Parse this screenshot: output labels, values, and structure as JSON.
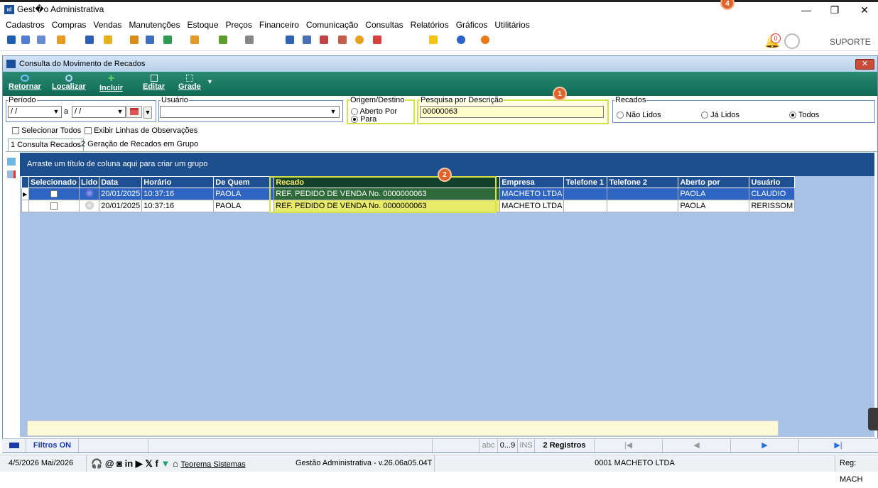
{
  "window": {
    "title": "Gest�o Administrativa",
    "badge": "4"
  },
  "menu": [
    "Cadastros",
    "Compras",
    "Vendas",
    "Manutenções",
    "Estoque",
    "Preços",
    "Financeiro",
    "Comunicação",
    "Consultas",
    "Relatórios",
    "Gráficos",
    "Utilitários"
  ],
  "topright": {
    "suporte": "SUPORTE",
    "bell_badge": "0"
  },
  "inner": {
    "title": "Consulta do Movimento de Recados",
    "close": "✕",
    "actions": [
      {
        "label": "Retornar",
        "color": "#6fc3ff"
      },
      {
        "label": "Localizar",
        "color": "#b8d6ff"
      },
      {
        "label": "Incluir",
        "color": "#5fd65f"
      },
      {
        "label": "Editar",
        "color": "#ffffff"
      },
      {
        "label": "Grade",
        "color": "#ffffff"
      }
    ]
  },
  "filters": {
    "periodo_legend": "Período",
    "date_from": " / /",
    "date_sep": "a",
    "date_to": " / /",
    "usuario_legend": "Usuário",
    "usuario_value": "",
    "origem_legend": "Origem/Destino",
    "origem_opt1": "Aberto Por",
    "origem_opt2": "Para",
    "pesquisa_legend": "Pesquisa por Descrição",
    "pesquisa_value": "00000063",
    "recados_legend": "Recados",
    "recados_opt1": "Não Lidos",
    "recados_opt2": "Já Lidos",
    "recados_opt3": "Todos",
    "selecionar_todos": "Selecionar Todos",
    "exibir_linhas": "Exibir Linhas de Observações",
    "badge1": "1",
    "badge2": "2"
  },
  "tabs": [
    "1 Consulta Recados",
    "2 Geração de Recados em Grupo"
  ],
  "grid": {
    "group_hint": "Arraste um título de coluna aqui para criar um grupo",
    "columns": [
      "Selecionado",
      "Lido",
      "Data",
      "Horário",
      "De Quem",
      "Recado",
      "Empresa",
      "Telefone 1",
      "Telefone 2",
      "Aberto por",
      "Usuário"
    ],
    "rows": [
      [
        "",
        "",
        "20/01/2025",
        "10:37:16",
        "PAOLA",
        "REF. PEDIDO DE VENDA No. 0000000063",
        "MACHETO LTDA",
        "",
        "",
        "PAOLA",
        "CLAUDIO"
      ],
      [
        "",
        "",
        "20/01/2025",
        "10:37:16",
        "PAOLA",
        "REF. PEDIDO DE VENDA No. 0000000063",
        "MACHETO LTDA",
        "",
        "",
        "PAOLA",
        "RERISSOM"
      ]
    ]
  },
  "status": {
    "filtros": "Filtros ON",
    "abc": "abc",
    "num": "0...9",
    "ins": "INS",
    "registros": "2 Registros",
    "nav_first": "|◀",
    "nav_prev": "◀",
    "nav_next": "▶",
    "nav_last": "▶|"
  },
  "bottom": {
    "date": "4/5/2026 Mai/2026",
    "brand": "Teorema Sistemas",
    "version": "Gestão Administrativa - v.26.06a05.04T",
    "company": "0001 MACHETO LTDA",
    "reg": "Reg: MACH"
  }
}
